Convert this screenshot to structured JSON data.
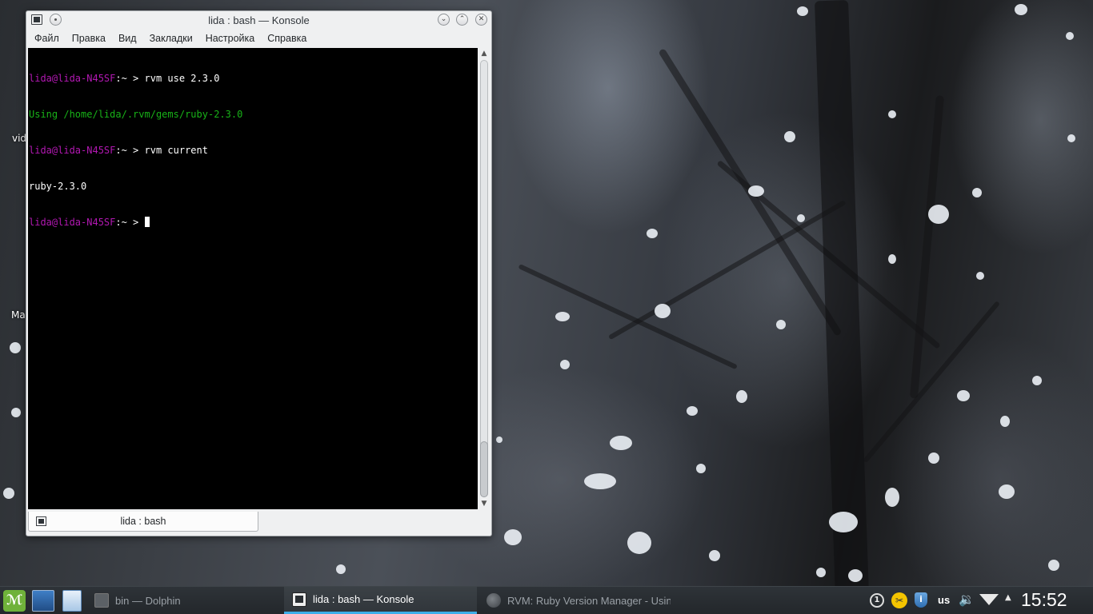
{
  "desktop": {
    "icon_labels": [
      "vid",
      "Ma"
    ]
  },
  "window": {
    "title": "lida : bash — Konsole",
    "menu": [
      "Файл",
      "Правка",
      "Вид",
      "Закладки",
      "Настройка",
      "Справка"
    ],
    "controls": {
      "minimize": "⌄",
      "maximize": "⌃",
      "close": "✕"
    }
  },
  "terminal": {
    "lines": [
      {
        "prompt": "lida@lida-N45SF",
        "path": ":~ > ",
        "command": "rvm use 2.3.0"
      },
      {
        "output": "Using /home/lida/.rvm/gems/ruby-2.3.0",
        "color": "green"
      },
      {
        "prompt": "lida@lida-N45SF",
        "path": ":~ > ",
        "command": "rvm current"
      },
      {
        "output": "ruby-2.3.0",
        "color": "white"
      },
      {
        "prompt": "lida@lida-N45SF",
        "path": ":~ > ",
        "command": ""
      }
    ],
    "colors": {
      "prompt": "#b218b2",
      "green": "#18b218",
      "background": "#000000"
    },
    "scroll_position": 1.0
  },
  "tabs": [
    {
      "label": "lida : bash",
      "active": true
    }
  ],
  "taskbar": {
    "launchers": [
      "mint-menu-icon",
      "show-desktop-icon",
      "file-manager-icon"
    ],
    "tasks": [
      {
        "label": "bin — Dolphin",
        "active": false
      },
      {
        "label": "lida : bash — Konsole",
        "active": true
      },
      {
        "label": "RVM: Ruby Version Manager - Using",
        "active": false
      }
    ],
    "tray": {
      "updates": "1",
      "keyboard_layout": "us",
      "clock": "15:52"
    },
    "accent_color": "#3daee9"
  }
}
